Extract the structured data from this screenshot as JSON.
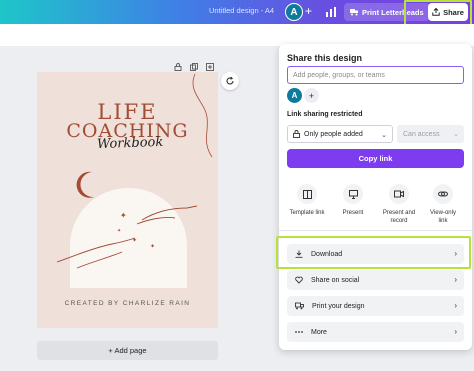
{
  "topbar": {
    "doc_title": "Untitled design - A4",
    "avatar_letter": "A",
    "plus": "+",
    "print_label": "Print Letterheads",
    "share_label": "Share"
  },
  "canvas": {
    "title_line1": "LIFE",
    "title_line2": "COACHING",
    "script": "Workbook",
    "created_by": "CREATED BY CHARLIZE RAIN",
    "add_page": "+ Add page"
  },
  "share_panel": {
    "title": "Share this design",
    "people_placeholder": "Add people, groups, or teams",
    "avatar_letter": "A",
    "plus": "+",
    "restriction_label": "Link sharing restricted",
    "access_select": "Only people added",
    "permission_select": "Can access",
    "copy_link": "Copy link",
    "options": [
      {
        "label": "Template link",
        "icon": "template-icon"
      },
      {
        "label": "Present",
        "icon": "present-icon"
      },
      {
        "label": "Present and record",
        "icon": "record-icon"
      },
      {
        "label": "View-only link",
        "icon": "link-icon"
      }
    ],
    "rows": [
      {
        "label": "Download",
        "icon": "download-icon"
      },
      {
        "label": "Share on social",
        "icon": "heart-icon"
      },
      {
        "label": "Print your design",
        "icon": "truck-icon"
      },
      {
        "label": "More",
        "icon": "more-icon"
      }
    ]
  },
  "colors": {
    "accent": "#7d3cf0",
    "highlight": "#b6e23b",
    "title_rust": "#a24b35"
  }
}
